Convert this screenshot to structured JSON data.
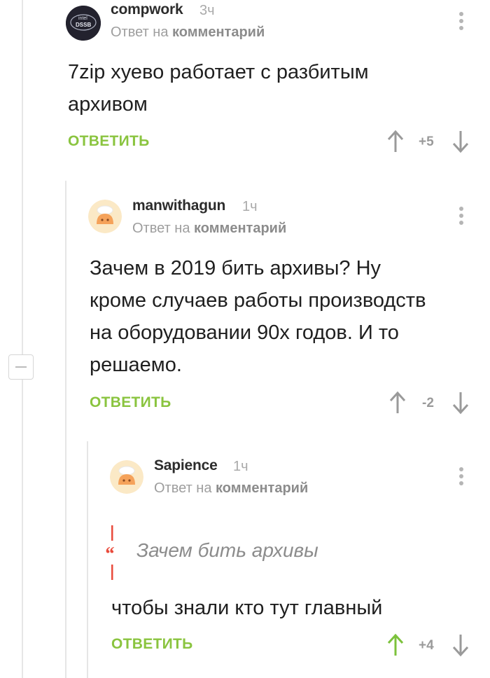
{
  "comments": [
    {
      "username": "compwork",
      "time": "3ч",
      "reply_prefix": "Ответ на",
      "reply_target": "комментарий",
      "text_lines": [
        "7zip хуево работает с разбитым",
        "архивом"
      ],
      "answer_label": "ОТВЕТИТЬ",
      "score": "+5",
      "upvoted": false,
      "avatar_text": [
        "intel",
        "DSSB"
      ]
    },
    {
      "username": "manwithagun",
      "time": "1ч",
      "reply_prefix": "Ответ на",
      "reply_target": "комментарий",
      "text_lines": [
        "Зачем в 2019 бить архивы? Ну",
        "кроме случаев работы производств",
        "на оборудовании 90х годов. И то",
        "решаемо."
      ],
      "answer_label": "ОТВЕТИТЬ",
      "score": "-2",
      "upvoted": false
    },
    {
      "username": "Sapience",
      "time": "1ч",
      "reply_prefix": "Ответ на",
      "reply_target": "комментарий",
      "quote": "Зачем бить архивы",
      "text_lines": [
        "чтобы знали кто тут главный"
      ],
      "answer_label": "ОТВЕТИТЬ",
      "score": "+4",
      "upvoted": true
    }
  ],
  "colors": {
    "accent_green": "#8ac43f",
    "quote_red": "#e94b3c",
    "muted_gray": "#9e9e9e"
  },
  "icons": {
    "vote_up": "arrow-up-icon",
    "vote_down": "arrow-down-icon",
    "menu": "kebab-menu-icon",
    "collapse": "minus-icon"
  }
}
